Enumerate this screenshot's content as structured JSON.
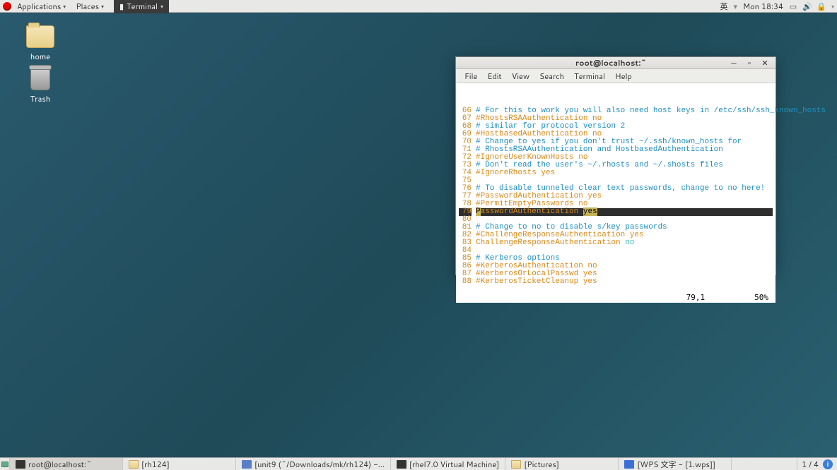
{
  "panel": {
    "applications": "Applications",
    "places": "Places",
    "terminal_menu": "Terminal",
    "ime": "英",
    "clock": "Mon 18:34"
  },
  "desktop": {
    "home": "home",
    "trash": "Trash"
  },
  "window": {
    "title": "root@localhost:~",
    "menubar": [
      "File",
      "Edit",
      "View",
      "Search",
      "Terminal",
      "Help"
    ],
    "pos": "79,1",
    "pct": "50%",
    "lines": [
      {
        "n": 66,
        "t": "# For this to work you will also need host keys in /etc/ssh/ssh_known_hosts",
        "c": "blue"
      },
      {
        "n": 67,
        "t": "#RhostsRSAAuthentication no",
        "c": "orange"
      },
      {
        "n": 68,
        "t": "# similar for protocol version 2",
        "c": "blue"
      },
      {
        "n": 69,
        "t": "#HostbasedAuthentication no",
        "c": "orange"
      },
      {
        "n": 70,
        "t": "# Change to yes if you don't trust ~/.ssh/known_hosts for",
        "c": "blue"
      },
      {
        "n": 71,
        "t": "# RhostsRSAAuthentication and HostbasedAuthentication",
        "c": "blue"
      },
      {
        "n": 72,
        "t": "#IgnoreUserKnownHosts no",
        "c": "orange"
      },
      {
        "n": 73,
        "t": "# Don't read the user's ~/.rhosts and ~/.shosts files",
        "c": "blue"
      },
      {
        "n": 74,
        "t": "#IgnoreRhosts yes",
        "c": "orange"
      },
      {
        "n": 75,
        "t": "",
        "c": "blue"
      },
      {
        "n": 76,
        "t": "# To disable tunneled clear text passwords, change to no here!",
        "c": "blue"
      },
      {
        "n": 77,
        "t": "#PasswordAuthentication yes",
        "c": "orange"
      },
      {
        "n": 78,
        "t": "#PermitEmptyPasswords no",
        "c": "orange"
      },
      {
        "n": 79,
        "t": "PasswordAuthentication ",
        "c": "hl",
        "tail": "yes"
      },
      {
        "n": 80,
        "t": "",
        "c": "blue"
      },
      {
        "n": 81,
        "t": "# Change to no to disable s/key passwords",
        "c": "blue"
      },
      {
        "n": 82,
        "t": "#ChallengeResponseAuthentication yes",
        "c": "orange"
      },
      {
        "n": 83,
        "t": "ChallengeResponseAuthentication ",
        "c": "orange",
        "tail": "no",
        "tailc": "teal"
      },
      {
        "n": 84,
        "t": "",
        "c": "blue"
      },
      {
        "n": 85,
        "t": "# Kerberos options",
        "c": "blue"
      },
      {
        "n": 86,
        "t": "#KerberosAuthentication no",
        "c": "orange"
      },
      {
        "n": 87,
        "t": "#KerberosOrLocalPasswd yes",
        "c": "orange"
      },
      {
        "n": 88,
        "t": "#KerberosTicketCleanup yes",
        "c": "orange"
      }
    ]
  },
  "taskbar": {
    "tasks": [
      {
        "label": "root@localhost:~",
        "icon": "term",
        "active": true
      },
      {
        "label": "[rh124]",
        "icon": "folder"
      },
      {
        "label": "[unit9 (~/Downloads/mk/rh124) -...",
        "icon": "doc"
      },
      {
        "label": "[rhel7.0 Virtual Machine]",
        "icon": "term"
      },
      {
        "label": "[Pictures]",
        "icon": "folder"
      },
      {
        "label": "[WPS 文字 - [1.wps]]",
        "icon": "wps"
      }
    ],
    "workspace": "1 / 4"
  }
}
